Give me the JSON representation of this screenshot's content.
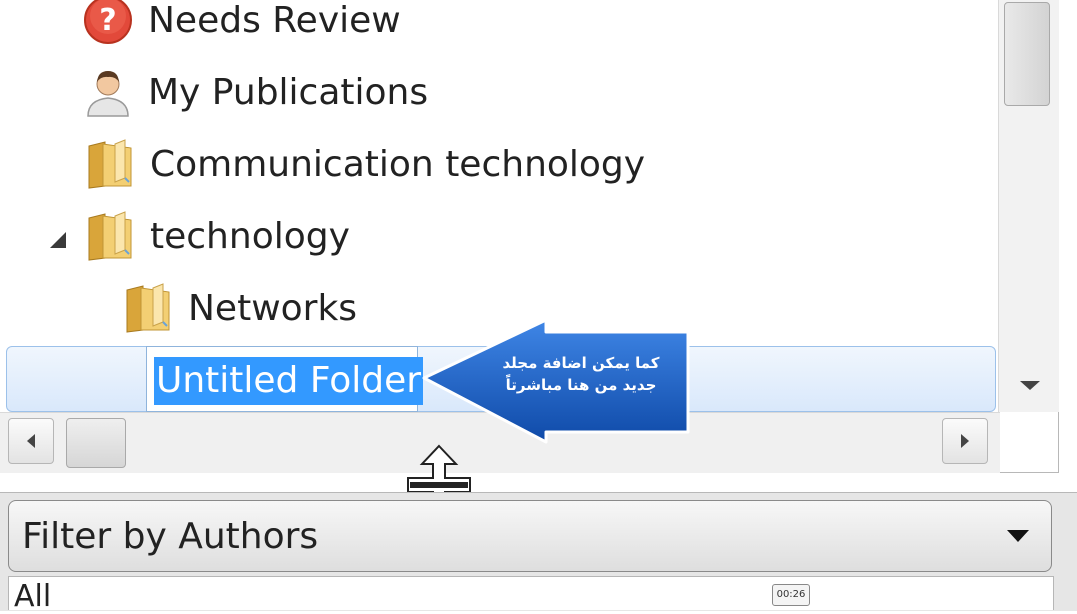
{
  "tree": {
    "items": [
      {
        "label": "Needs Review",
        "icon": "question-circle-icon"
      },
      {
        "label": "My Publications",
        "icon": "person-icon"
      },
      {
        "label": "Communication technology",
        "icon": "folder-icon"
      },
      {
        "label": "technology",
        "icon": "folder-icon",
        "expanded": true
      },
      {
        "label": "Networks",
        "icon": "folder-icon"
      }
    ],
    "rename_value": "Untitled Folder"
  },
  "callout": {
    "line1": "كما يمكن اضافة مجلد",
    "line2": "جديد من هنا مباشرتاً",
    "color": "#1e63c9"
  },
  "filter": {
    "label": "Filter by Authors"
  },
  "authors_list": {
    "first_item": "All"
  },
  "video": {
    "timestamp": "00:26"
  },
  "colors": {
    "selection": "#3399ff",
    "row_highlight": "#d9e8fb",
    "folder": "#e8b84a"
  }
}
